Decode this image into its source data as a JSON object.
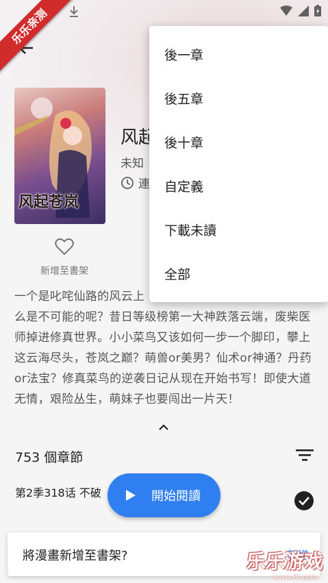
{
  "ribbon": {
    "label": "乐乐亲测"
  },
  "manga": {
    "title": "风起",
    "author": "未知",
    "status": "連",
    "cover_title": "风起苍岚"
  },
  "favorite": {
    "label": "新增至書架",
    "icon": "heart-outline-icon"
  },
  "description": "一个是叱咤仙路的风云上 菜鸟，当网游遭遇修真，还有什么是不可能的呢？昔日等级榜第一大神跌落云端，废柴医师掉进修真世界。小小菜鸟又该如何一步一个脚印，攀上这云海尽头，苍岚之巅？萌兽or美男？仙术or神通？丹药or法宝？修真菜鸟的逆袭日记从现在开始书写！即使大道无情，艰险丛生，萌妹子也要闯出一片天！",
  "chapters": {
    "count_label": "753 個章節",
    "first_row": "第2季318话 不破"
  },
  "start_button": {
    "label": "開始閱讀"
  },
  "snackbar": {
    "text": "將漫畫新增至書架?",
    "action": "新增"
  },
  "watermark": {
    "text": "乐乐游戏",
    "url": "www.6l.com"
  },
  "menu": {
    "items": [
      {
        "label": "後一章"
      },
      {
        "label": "後五章"
      },
      {
        "label": "後十章"
      },
      {
        "label": "自定義"
      },
      {
        "label": "下載未讀"
      },
      {
        "label": "全部"
      }
    ]
  },
  "colors": {
    "accent": "#2f7ff0",
    "ribbon": "#d22b2b"
  }
}
